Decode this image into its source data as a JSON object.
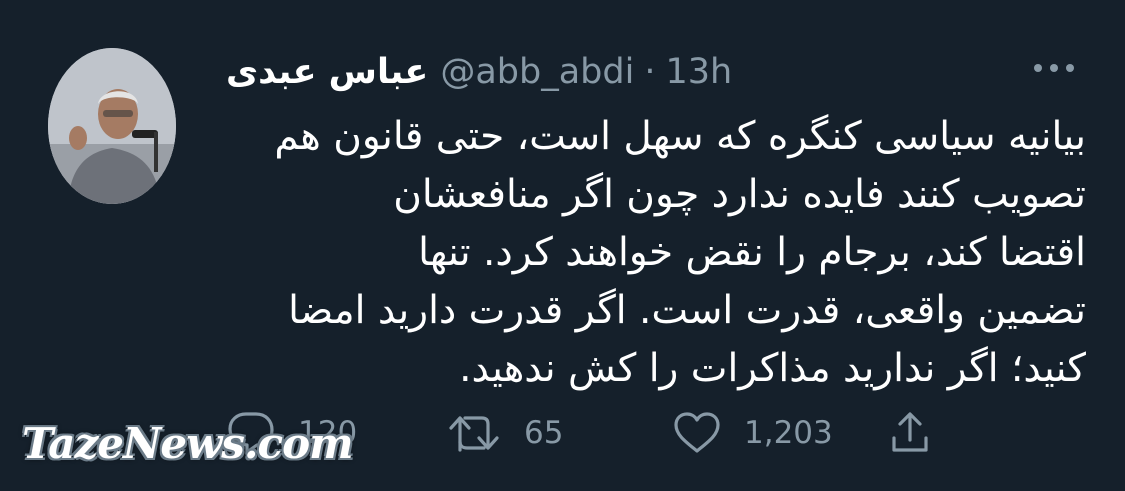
{
  "tweet": {
    "display_name": "عباس عبدی",
    "handle": "@abb_abdi",
    "separator": "·",
    "time": "13h",
    "text": "بیانیه سیاسی کنگره که سهل است، حتی قانون هم\nتصویب کنند فایده ندارد چون اگر منافعشان\nاقتضا کند، برجام را نقض خواهند کرد. تنها\nتضمین واقعی، قدرت است. اگر قدرت دارید امضا\nکنید؛ اگر ندارید مذاکرات را کش ندهید."
  },
  "actions": {
    "reply_count": "120",
    "retweet_count": "65",
    "like_count": "1,203"
  },
  "icons": {
    "reply": "reply-icon",
    "retweet": "retweet-icon",
    "like": "heart-icon",
    "share": "share-icon",
    "more": "more-icon"
  },
  "watermark": "TazeNews.com",
  "colors": {
    "background": "#15202b",
    "text": "#ffffff",
    "secondary": "#8899a6"
  }
}
